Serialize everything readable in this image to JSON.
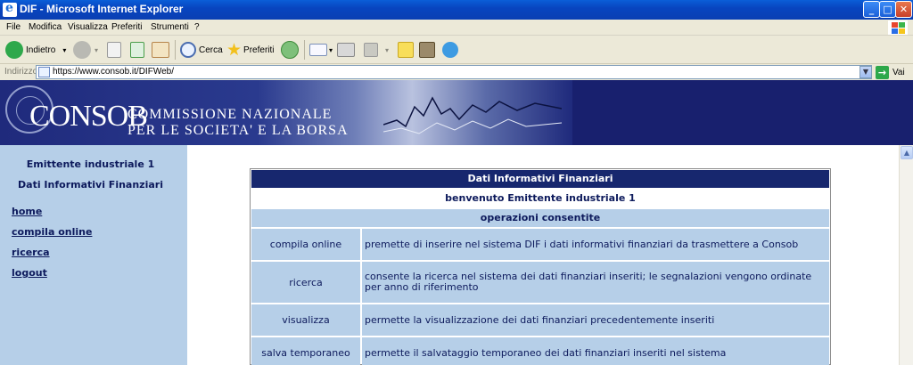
{
  "window": {
    "title": "DIF - Microsoft Internet Explorer",
    "controls": {
      "minimize": "_",
      "maximize": "□",
      "close": "✕"
    }
  },
  "menu": [
    "File",
    "Modifica",
    "Visualizza",
    "Preferiti",
    "Strumenti",
    "?"
  ],
  "toolbar": {
    "back_label": "Indietro",
    "search_label": "Cerca",
    "favorites_label": "Preferiti"
  },
  "address": {
    "label": "Indirizzo",
    "url": "https://www.consob.it/DIFWeb/",
    "go_label": "Vai"
  },
  "banner": {
    "logo": "CONSOB",
    "line1": "COMMISSIONE NAZIONALE",
    "line2": "PER LE SOCIETA' E LA BORSA"
  },
  "sidebar": {
    "user": "Emittente industriale 1",
    "section": "Dati Informativi Finanziari",
    "links": [
      "home",
      "compila online",
      "ricerca",
      "logout"
    ]
  },
  "content": {
    "title": "Dati Informativi Finanziari",
    "welcome": "benvenuto Emittente industriale 1",
    "ops_header": "operazioni consentite",
    "rows": [
      {
        "op": "compila online",
        "desc": "premette di inserire nel sistema DIF i dati informativi finanziari da trasmettere a Consob"
      },
      {
        "op": "ricerca",
        "desc": "consente la ricerca nel sistema dei dati finanziari inseriti; le segnalazioni vengono ordinate per anno di riferimento"
      },
      {
        "op": "visualizza",
        "desc": "permette la visualizzazione dei dati finanziari precedentemente inseriti"
      },
      {
        "op": "salva temporaneo",
        "desc": "permette il salvataggio temporaneo dei dati finanziari inseriti nel sistema"
      }
    ]
  },
  "colors": {
    "banner_navy": "#18206e",
    "sidebar_blue": "#b6cfe8",
    "text_navy": "#0d1a5c",
    "xp_title": "#0845c0"
  }
}
